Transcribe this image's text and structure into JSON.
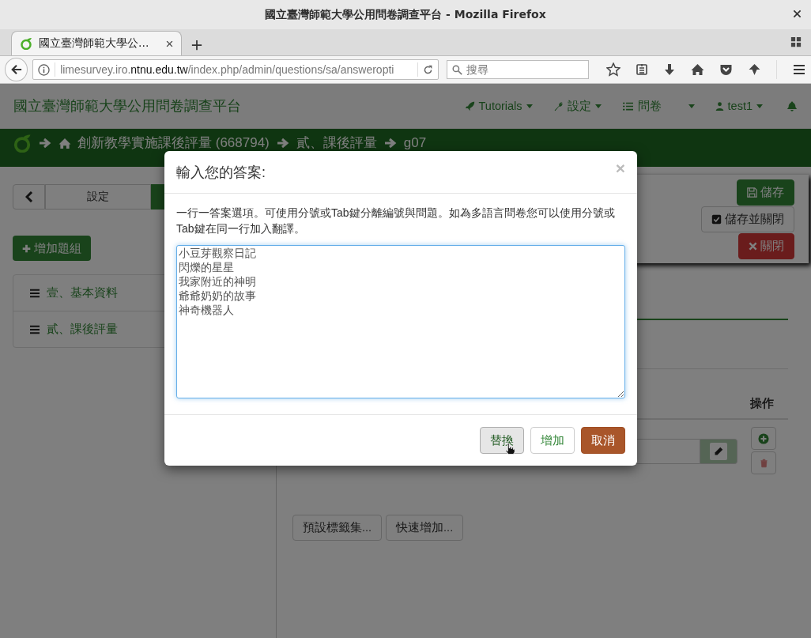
{
  "window": {
    "title": "國立臺灣師範大學公用問卷調查平台 - Mozilla Firefox"
  },
  "tabs": [
    {
      "label": "國立臺灣師範大學公...",
      "selected": true
    }
  ],
  "address_bar": {
    "url": "limesurvey.iro.**ntnu.edu.tw**/index.php/admin/questions/sa/answeropti"
  },
  "search": {
    "placeholder": "搜尋"
  },
  "navbar": {
    "brand": "國立臺灣師範大學公用問卷調查平台",
    "menus": [
      {
        "kind": "rocket",
        "label": "Tutorials"
      },
      {
        "kind": "wrench",
        "label": "設定"
      },
      {
        "kind": "list",
        "label": "問卷"
      },
      {
        "kind": "user",
        "label": "test1"
      }
    ]
  },
  "breadcrumb": [
    "創新教學實施課後評量 (668794)",
    "貳、課後評量",
    "g07"
  ],
  "sidebar": {
    "tabs": [
      {
        "label": "設定",
        "selected": false
      },
      {
        "selected": true
      }
    ],
    "add_group_button": "增加題組",
    "groups": [
      "壹、基本資料",
      "貳、課後評量"
    ]
  },
  "save_panel": [
    {
      "kind": "save",
      "label": "儲存"
    },
    {
      "kind": "save_close",
      "label": "儲存並關閉"
    },
    {
      "kind": "close",
      "label": "關閉"
    }
  ],
  "answers_table": {
    "columns": [
      "操作"
    ]
  },
  "bottom_buttons": [
    "預設標籤集...",
    "快速增加..."
  ],
  "modal": {
    "title": "輸入您的答案:",
    "close": "×",
    "instructions": "一行一答案選項。可使用分號或Tab鍵分離編號與問題。如為多語言問卷您可以使用分號或Tab鍵在同一行加入翻譯。",
    "lines": [
      "小豆芽觀察日記",
      "閃爍的星星",
      "我家附近的神明",
      "爺爺奶奶的故事",
      "神奇機器人"
    ],
    "buttons": [
      {
        "kind": "default",
        "label": "替換",
        "hovered": true
      },
      {
        "kind": "default",
        "label": "增加",
        "hovered": false
      },
      {
        "kind": "danger",
        "label": "取消",
        "hovered": false
      }
    ]
  }
}
